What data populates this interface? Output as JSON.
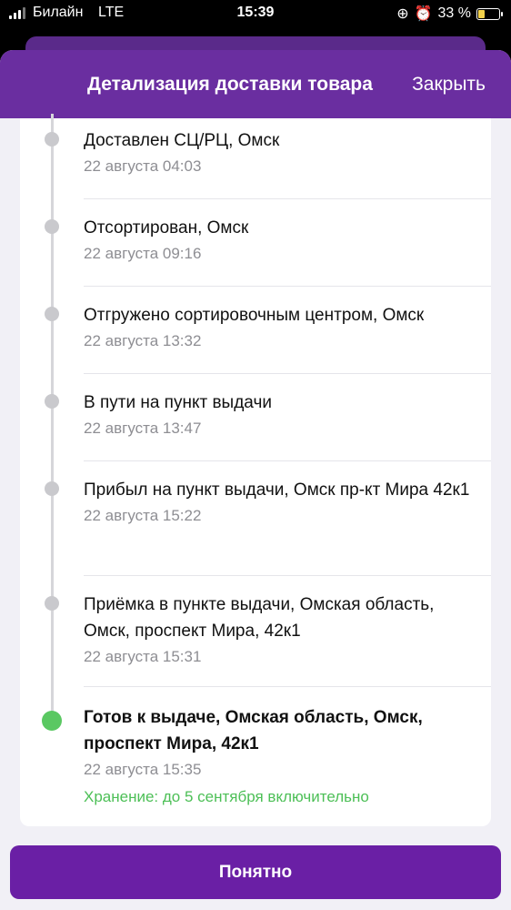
{
  "status_bar": {
    "carrier": "Билайн",
    "network": "LTE",
    "time": "15:39",
    "battery": "33 %"
  },
  "header": {
    "title": "Детализация доставки товара",
    "close_label": "Закрыть"
  },
  "events": [
    {
      "name": "Доставлен СЦ/РЦ, Омск",
      "date": "22 августа 04:03"
    },
    {
      "name": "Отсортирован, Омск",
      "date": "22 августа 09:16"
    },
    {
      "name": "Отгружено сортировочным центром, Омск",
      "date": "22 августа 13:32"
    },
    {
      "name": "В пути на пункт выдачи",
      "date": "22 августа 13:47"
    },
    {
      "name": "Прибыл на пункт выдачи, Омск пр-кт Мира 42к1",
      "date": "22 августа 15:22"
    },
    {
      "name": "Приёмка в пункте выдачи, Омская область, Омск, проспект Мира, 42к1",
      "date": "22 августа 15:31"
    },
    {
      "name": "Готов к выдаче, Омская область, Омск, проспект Мира, 42к1",
      "date": "22 августа 15:35",
      "storage": "Хранение: до 5 сентября включительно"
    }
  ],
  "footer": {
    "ok_label": "Понятно"
  },
  "colors": {
    "header": "#6a2ea0",
    "button": "#6a1fa5",
    "active_dot": "#5ac862",
    "storage_text": "#4cbf56"
  }
}
